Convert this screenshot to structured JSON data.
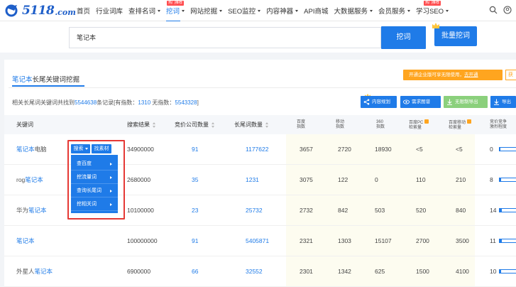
{
  "logo": {
    "text": "5118",
    "suffix": ".com"
  },
  "nav": {
    "items": [
      {
        "label": "首页",
        "caret": false,
        "active": false,
        "hot": false
      },
      {
        "label": "行业词库",
        "caret": false,
        "active": false,
        "hot": false
      },
      {
        "label": "查排名词",
        "caret": true,
        "active": false,
        "hot": false
      },
      {
        "label": "挖词",
        "caret": true,
        "active": true,
        "hot": true
      },
      {
        "label": "网站挖掘",
        "caret": true,
        "active": false,
        "hot": false
      },
      {
        "label": "SEO监控",
        "caret": true,
        "active": false,
        "hot": false
      },
      {
        "label": "内容神器",
        "caret": true,
        "active": false,
        "hot": false
      },
      {
        "label": "API商城",
        "caret": false,
        "active": false,
        "hot": false
      },
      {
        "label": "大数据服务",
        "caret": true,
        "active": false,
        "hot": false
      },
      {
        "label": "会员服务",
        "caret": true,
        "active": false,
        "hot": false
      },
      {
        "label": "学习SEO",
        "caret": true,
        "active": false,
        "hot": true
      }
    ],
    "hot_badge": "热门推荐"
  },
  "search": {
    "value": "笔记本",
    "btn_wajue": "挖词",
    "btn_batch": "批量挖词"
  },
  "panel": {
    "title_hl": "笔记本",
    "title_rest": "长尾关键词挖掘",
    "promo_text": "开通企业版可享无限使用，",
    "promo_link": "去开通",
    "promo_right": "获"
  },
  "summary": {
    "prefix": "相关长尾词关键词共找到",
    "total": "5544638",
    "mid1": "条记录[有指数：",
    "with_index": "1310",
    "mid2": " 无指数：",
    "no_index": "5543328",
    "suffix": "]"
  },
  "toolbar": {
    "b1": "内容规划",
    "b2": "需求图谱",
    "b3": "无限制导出",
    "b4": "导出"
  },
  "table": {
    "headers": {
      "keyword": "关键词",
      "results": "搜索结果",
      "bidders": "竞价公司数量",
      "longtail": "长尾词数量",
      "baidu_idx_1": "百度",
      "baidu_idx_2": "指数",
      "mobile_idx_1": "移动",
      "mobile_idx_2": "指数",
      "s360_idx_1": "360",
      "s360_idx_2": "指数",
      "pc_vol_1": "百度PC",
      "pc_vol_2": "检索量",
      "mob_vol_1": "百度移动",
      "mob_vol_2": "检索量",
      "compete_1": "竞价竞争",
      "compete_2": "激烈程度"
    },
    "rows": [
      {
        "kw_pre": "",
        "kw_hl": "笔记本",
        "kw_post": "电脑",
        "results": "34900000",
        "bidders": "91",
        "longtail": "1177622",
        "baidu": "3657",
        "mobile": "2720",
        "s360": "18930",
        "pc": "<5",
        "mob": "<5",
        "compete": "0",
        "compete_level": 0.0
      },
      {
        "kw_pre": "rog",
        "kw_hl": "笔记本",
        "kw_post": "",
        "results": "2680000",
        "bidders": "35",
        "longtail": "1231",
        "baidu": "3075",
        "mobile": "122",
        "s360": "0",
        "pc": "110",
        "mob": "210",
        "compete": "8",
        "compete_level": 0.08
      },
      {
        "kw_pre": "华为",
        "kw_hl": "笔记本",
        "kw_post": "",
        "results": "10100000",
        "bidders": "23",
        "longtail": "25732",
        "baidu": "2732",
        "mobile": "842",
        "s360": "503",
        "pc": "520",
        "mob": "840",
        "compete": "14",
        "compete_level": 0.14
      },
      {
        "kw_pre": "",
        "kw_hl": "笔记本",
        "kw_post": "",
        "results": "100000000",
        "bidders": "91",
        "longtail": "5405871",
        "baidu": "2321",
        "mobile": "1303",
        "s360": "15107",
        "pc": "2700",
        "mob": "3500",
        "compete": "11",
        "compete_level": 0.11
      },
      {
        "kw_pre": "外星人",
        "kw_hl": "笔记本",
        "kw_post": "",
        "results": "6900000",
        "bidders": "66",
        "longtail": "32552",
        "baidu": "2301",
        "mobile": "1342",
        "s360": "625",
        "pc": "1500",
        "mob": "4100",
        "compete": "10",
        "compete_level": 0.1
      }
    ]
  },
  "row_actions": {
    "search_btn": "搜索",
    "find_btn": "找素材"
  },
  "dropdown": {
    "items": [
      "查百度",
      "挖流量词",
      "查询长尾词",
      "挖相关词"
    ]
  },
  "colors": {
    "primary": "#1f7be8",
    "promo": "#ffa51f",
    "highlight": "#e53935"
  }
}
